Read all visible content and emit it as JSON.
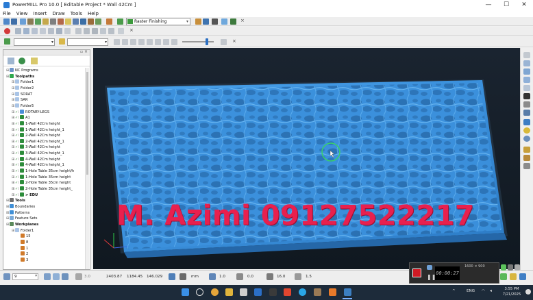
{
  "window": {
    "title": "PowerMILL Pro 10.0     [ Editable Project * Wall 42Cm ]",
    "controls": [
      "—",
      "☐",
      "✕"
    ]
  },
  "menu": [
    "File",
    "View",
    "Insert",
    "Draw",
    "Tools",
    "Help"
  ],
  "toolbar": {
    "strategy": "Raster Finishing",
    "close": "×"
  },
  "explorer": {
    "tree": [
      {
        "label": "NC Programs",
        "level": 0,
        "bold": false,
        "icon": "#6d94c9"
      },
      {
        "label": "Toolpaths",
        "level": 0,
        "bold": true,
        "icon": "#2fa84f"
      },
      {
        "label": "Folder1",
        "level": 1,
        "icon": "#a9c4e6"
      },
      {
        "label": "Folder2",
        "level": 1,
        "icon": "#a9c4e6"
      },
      {
        "label": "SORAT",
        "level": 1,
        "icon": "#a9c4e6"
      },
      {
        "label": "SAR",
        "level": 1,
        "icon": "#a9c4e6"
      },
      {
        "label": "Folder5",
        "level": 1,
        "icon": "#a9c4e6"
      },
      {
        "label": "ROTARY-LEGS",
        "level": 1,
        "check": true,
        "icon": "#4a8ed8"
      },
      {
        "label": "A1",
        "level": 1,
        "check": true,
        "icon": "#2d8c3b"
      },
      {
        "label": "1-Wall 42Cm height",
        "level": 1,
        "check": true,
        "icon": "#2d8c3b"
      },
      {
        "label": "1-Wall 42Cm height_1",
        "level": 1,
        "check": true,
        "icon": "#2d8c3b"
      },
      {
        "label": "2-Wall 42Cm height",
        "level": 1,
        "check": true,
        "icon": "#2d8c3b"
      },
      {
        "label": "2-Wall 42Cm height_1",
        "level": 1,
        "check": true,
        "icon": "#2d8c3b"
      },
      {
        "label": "3-Wall 42Cm height",
        "level": 1,
        "check": true,
        "icon": "#2d8c3b"
      },
      {
        "label": "3-Wall 42Cm height_1",
        "level": 1,
        "check": true,
        "icon": "#2d8c3b"
      },
      {
        "label": "4-Wall 42Cm height",
        "level": 1,
        "check": true,
        "icon": "#2d8c3b"
      },
      {
        "label": "4-Wall 42Cm height_1",
        "level": 1,
        "check": true,
        "icon": "#2d8c3b"
      },
      {
        "label": "1-Hole Table 35cm height/h",
        "level": 1,
        "check": true,
        "icon": "#2d8c3b"
      },
      {
        "label": "1-Hole Table 35cm height",
        "level": 1,
        "check": true,
        "icon": "#2d8c3b"
      },
      {
        "label": "2-Hole Table 35cm height",
        "level": 1,
        "check": true,
        "icon": "#2d8c3b"
      },
      {
        "label": "2-Hole Table 35cm height_",
        "level": 1,
        "check": true,
        "icon": "#2d8c3b"
      },
      {
        "label": "> EDU",
        "level": 1,
        "bold": true,
        "check": true,
        "icon": "#2d8c3b"
      },
      {
        "label": "Tools",
        "level": 0,
        "bold": true,
        "icon": "#6f6f6f"
      },
      {
        "label": "Boundaries",
        "level": 0,
        "icon": "#3f8fd6"
      },
      {
        "label": "Patterns",
        "level": 0,
        "icon": "#3f8fd6"
      },
      {
        "label": "Feature Sets",
        "level": 0,
        "icon": "#7aaad8"
      },
      {
        "label": "Workplanes",
        "level": 0,
        "bold": true,
        "icon": "#5c8a5c"
      },
      {
        "label": "Folder1",
        "level": 1,
        "icon": "#a9c4e6"
      },
      {
        "label": "15",
        "level": 2,
        "icon": "#d07a2a"
      },
      {
        "label": "8",
        "level": 2,
        "icon": "#d07a2a"
      },
      {
        "label": "1",
        "level": 2,
        "icon": "#d07a2a"
      },
      {
        "label": "2",
        "level": 2,
        "icon": "#d07a2a"
      },
      {
        "label": "3",
        "level": 2,
        "icon": "#d07a2a"
      }
    ]
  },
  "viewport": {
    "watermark": "M. Azimi 09127522217",
    "model_color": "#3a8fd9"
  },
  "statusbar": {
    "workplane": "9",
    "tolerance": "3.0",
    "x": "2403.87",
    "y": "1184.45",
    "z": "146.029",
    "units": "mm",
    "step1": "1.0",
    "step2": "0.0",
    "angle": "16.0",
    "step3": "1.5"
  },
  "recorder": {
    "timer": "00:00:27",
    "resolution": "1600 × 900"
  },
  "taskbar": {
    "language": "ENG",
    "time": "3:55 PM",
    "date": "7/21/2025"
  }
}
